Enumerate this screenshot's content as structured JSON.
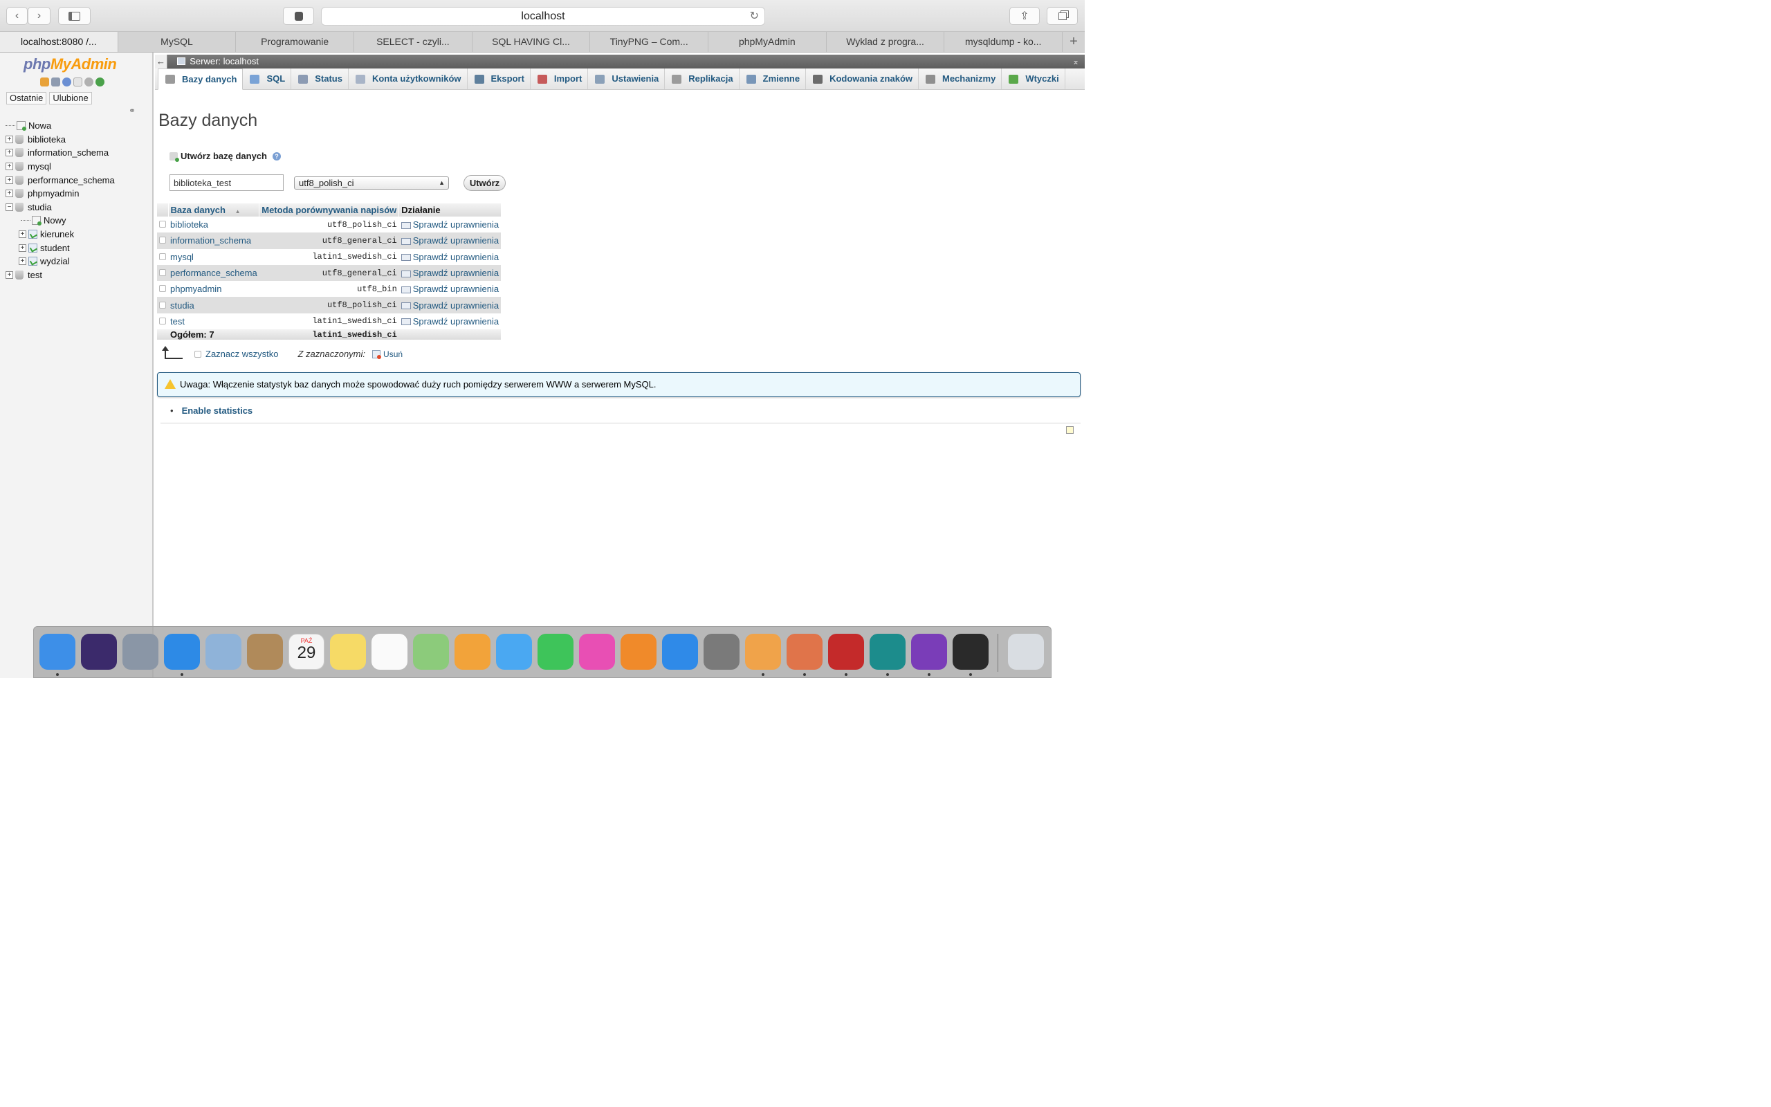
{
  "browser": {
    "address": "localhost",
    "tabs": [
      "localhost:8080 /...",
      "MySQL",
      "Programowanie",
      "SELECT - czyli...",
      "SQL HAVING Cl...",
      "TinyPNG – Com...",
      "phpMyAdmin",
      "Wyklad z progra...",
      "mysqldump - ko..."
    ],
    "new_tab": "+"
  },
  "sidebar": {
    "logo_php": "php",
    "logo_myadmin": "MyAdmin",
    "recent_button": "Ostatnie",
    "favorites_button": "Ulubione",
    "tree": {
      "new": "Nowa",
      "databases": [
        "biblioteka",
        "information_schema",
        "mysql",
        "performance_schema",
        "phpmyadmin"
      ],
      "studia": "studia",
      "studia_new": "Nowy",
      "studia_tables": [
        "kierunek",
        "student",
        "wydzial"
      ],
      "test": "test"
    }
  },
  "server_bar": {
    "back": "←",
    "label": "Serwer: localhost"
  },
  "tabs": [
    {
      "label": "Bazy danych",
      "color": "#9a9a9a"
    },
    {
      "label": "SQL",
      "color": "#7aa3d6"
    },
    {
      "label": "Status",
      "color": "#8c9bb3"
    },
    {
      "label": "Konta użytkowników",
      "color": "#a8b4c7"
    },
    {
      "label": "Eksport",
      "color": "#5e7f9c"
    },
    {
      "label": "Import",
      "color": "#c65a5a"
    },
    {
      "label": "Ustawienia",
      "color": "#8aa0b8"
    },
    {
      "label": "Replikacja",
      "color": "#9b9b9b"
    },
    {
      "label": "Zmienne",
      "color": "#7896b8"
    },
    {
      "label": "Kodowania znaków",
      "color": "#6b6b6b"
    },
    {
      "label": "Mechanizmy",
      "color": "#8f8f8f"
    },
    {
      "label": "Wtyczki",
      "color": "#5aa84a"
    }
  ],
  "page": {
    "title": "Bazy danych",
    "create_heading": "Utwórz bazę danych",
    "db_name_value": "biblioteka_test",
    "collation_value": "utf8_polish_ci",
    "create_button": "Utwórz"
  },
  "table": {
    "headers": {
      "database": "Baza danych",
      "collation": "Metoda porównywania napisów",
      "action": "Działanie"
    },
    "rows": [
      {
        "name": "biblioteka",
        "collation": "utf8_polish_ci",
        "action": "Sprawdź uprawnienia"
      },
      {
        "name": "information_schema",
        "collation": "utf8_general_ci",
        "action": "Sprawdź uprawnienia"
      },
      {
        "name": "mysql",
        "collation": "latin1_swedish_ci",
        "action": "Sprawdź uprawnienia"
      },
      {
        "name": "performance_schema",
        "collation": "utf8_general_ci",
        "action": "Sprawdź uprawnienia"
      },
      {
        "name": "phpmyadmin",
        "collation": "utf8_bin",
        "action": "Sprawdź uprawnienia"
      },
      {
        "name": "studia",
        "collation": "utf8_polish_ci",
        "action": "Sprawdź uprawnienia"
      },
      {
        "name": "test",
        "collation": "latin1_swedish_ci",
        "action": "Sprawdź uprawnienia"
      }
    ],
    "total_label": "Ogółem: 7",
    "total_collation": "latin1_swedish_ci"
  },
  "selection": {
    "select_all": "Zaznacz wszystko",
    "with_selected": "Z zaznaczonymi:",
    "delete": "Usuń"
  },
  "notice": {
    "text": "Uwaga: Włączenie statystyk baz danych może spowodować duży ruch pomiędzy serwerem WWW a serwerem MySQL."
  },
  "enable_statistics": "Enable statistics",
  "dock": {
    "apps": [
      {
        "name": "finder-icon",
        "color": "#3d8fe8",
        "running": true
      },
      {
        "name": "siri-icon",
        "color": "#3b2a6b",
        "running": false
      },
      {
        "name": "launchpad-icon",
        "color": "#8a96a6",
        "running": false
      },
      {
        "name": "safari-icon",
        "color": "#2d8ae6",
        "running": true
      },
      {
        "name": "mail-icon",
        "color": "#8fb3d9",
        "running": false
      },
      {
        "name": "contacts-icon",
        "color": "#b08a5a",
        "running": false
      },
      {
        "name": "calendar-icon",
        "color": "#f5f5f5",
        "running": false
      },
      {
        "name": "notes-icon",
        "color": "#f6da66",
        "running": false
      },
      {
        "name": "reminders-icon",
        "color": "#fafafa",
        "running": false
      },
      {
        "name": "maps-icon",
        "color": "#8ccb7b",
        "running": false
      },
      {
        "name": "photos-icon",
        "color": "#f2a33a",
        "running": false
      },
      {
        "name": "messages-icon",
        "color": "#4aa8f2",
        "running": false
      },
      {
        "name": "facetime-icon",
        "color": "#3ec45a",
        "running": false
      },
      {
        "name": "itunes-icon",
        "color": "#e84fb4",
        "running": false
      },
      {
        "name": "ibooks-icon",
        "color": "#f08a2a",
        "running": false
      },
      {
        "name": "appstore-icon",
        "color": "#2f8ae8",
        "running": false
      },
      {
        "name": "system-preferences-icon",
        "color": "#7a7a7a",
        "running": false
      },
      {
        "name": "pages-icon",
        "color": "#f0a34a",
        "running": true
      },
      {
        "name": "xampp-icon",
        "color": "#e0744a",
        "running": true
      },
      {
        "name": "filezilla-icon",
        "color": "#c42a2a",
        "running": true
      },
      {
        "name": "eset-icon",
        "color": "#1c8c8c",
        "running": true
      },
      {
        "name": "phpstorm-icon",
        "color": "#7a3db8",
        "running": true
      },
      {
        "name": "terminal-icon",
        "color": "#2a2a2a",
        "running": true
      },
      {
        "name": "trash-icon",
        "color": "#d9dde2",
        "running": false
      }
    ],
    "calendar_month": "PAŹ",
    "calendar_day": "29"
  }
}
